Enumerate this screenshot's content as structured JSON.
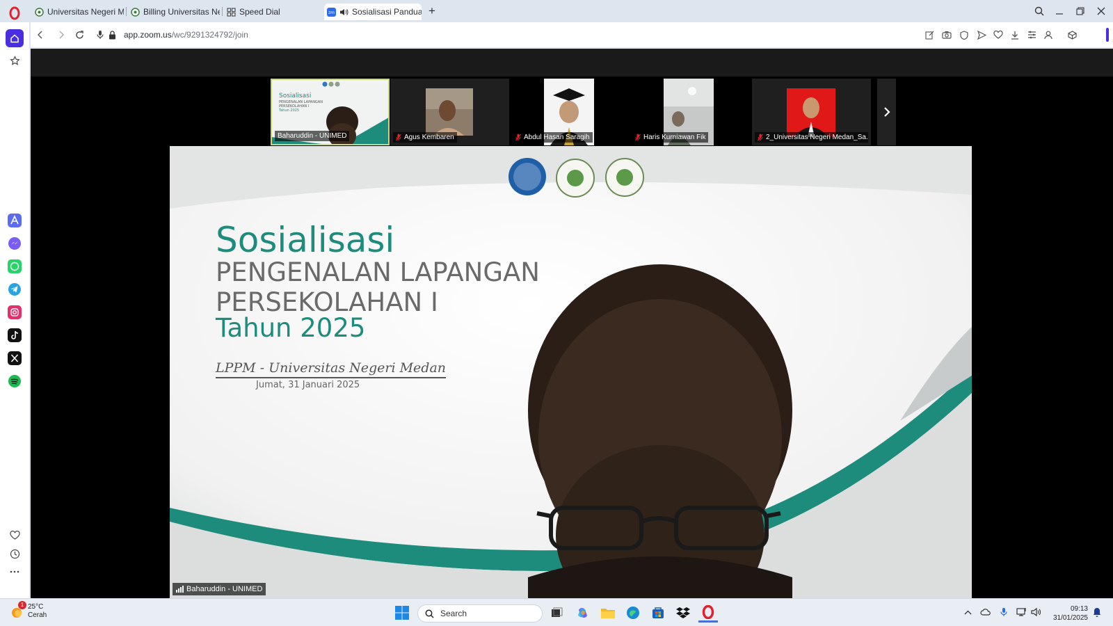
{
  "browser": {
    "tabs": [
      {
        "title": "Universitas Negeri Medan",
        "active": false
      },
      {
        "title": "Billing Universitas Negeri N",
        "active": false
      },
      {
        "title": "Speed Dial",
        "active": false
      },
      {
        "title": "Sosialisasi Panduan Ke",
        "active": true
      }
    ],
    "new_tab_label": "+",
    "url_domain": "app.zoom.us",
    "url_path": "/wc/9291324792/join"
  },
  "sidebar": {
    "items": [
      "home-icon",
      "bookmark-star-icon",
      "aria-icon",
      "messenger-icon",
      "whatsapp-icon",
      "telegram-icon",
      "instagram-icon",
      "tiktok-icon",
      "x-icon",
      "spotify-icon",
      "heart-icon",
      "history-icon",
      "more-icon"
    ]
  },
  "zoom": {
    "participants": [
      {
        "name": "Baharuddin - UNIMED",
        "muted": false,
        "active": true
      },
      {
        "name": "Agus Kembaren",
        "muted": true
      },
      {
        "name": "Abdul Hasan Saragih",
        "muted": true
      },
      {
        "name": "Haris Kurniawan Fik",
        "muted": true
      },
      {
        "name": "2_Universitas Negeri Medan_Sa...",
        "muted": true
      }
    ],
    "speaker_name": "Baharuddin - UNIMED",
    "slide": {
      "title": "Sosialisasi",
      "line1": "PENGENALAN LAPANGAN",
      "line2": "PERSEKOLAHAN I",
      "line3": "Tahun 2025",
      "org": "LPPM - Universitas Negeri Medan",
      "date": "Jumat, 31 Januari 2025"
    },
    "thumb_slide": {
      "title": "Sosialisasi",
      "line1": "PENGENALAN LAPANGAN",
      "line2": "PERSEKOLAHAN I",
      "line3": "Tahun 2025"
    }
  },
  "taskbar": {
    "weather_temp": "25°C",
    "weather_desc": "Cerah",
    "weather_badge": "1",
    "search_placeholder": "Search",
    "time": "09:13",
    "date": "31/01/2025"
  },
  "colors": {
    "slide_green": "#1e8c7c",
    "zoom_bg": "#000000",
    "opera_red": "#e0212f",
    "accent": "#4b2ee0"
  }
}
